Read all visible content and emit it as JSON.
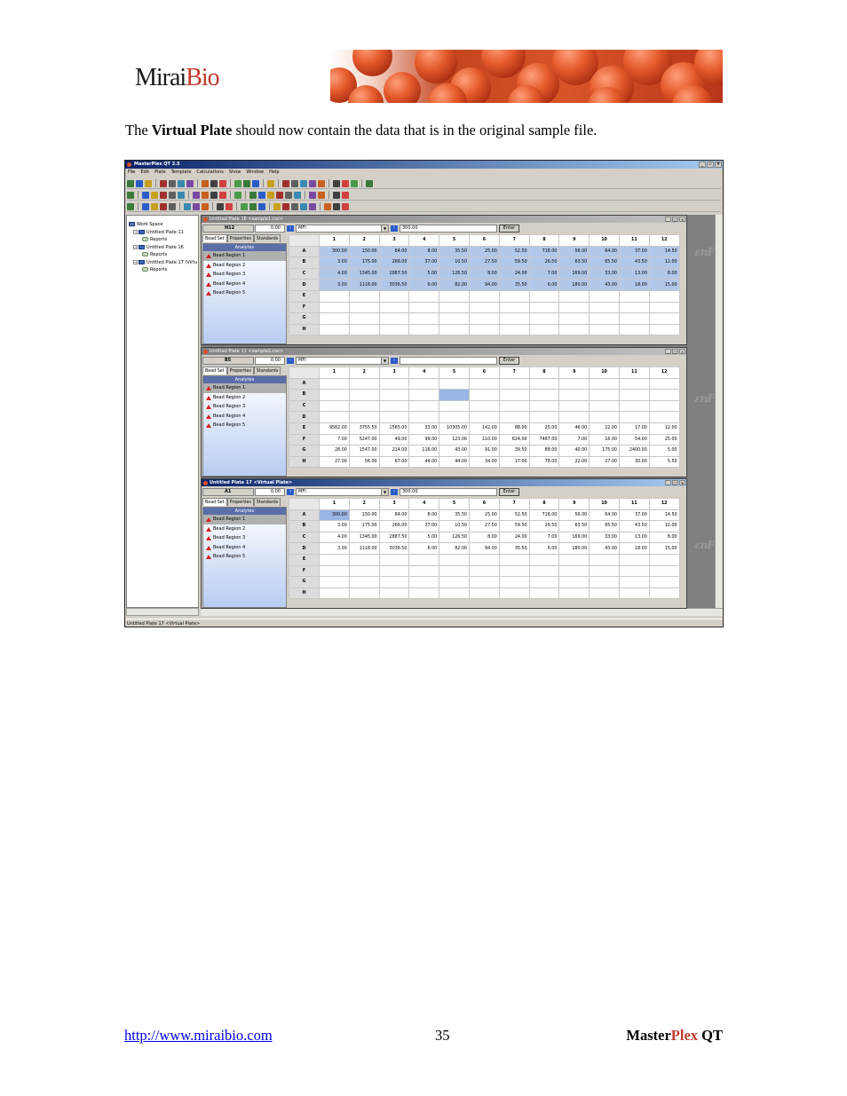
{
  "logo": {
    "part1": "Mirai",
    "part2": "Bio"
  },
  "intro": {
    "before": "The ",
    "bold": "Virtual Plate",
    "after": " should now contain the data that is in the original sample file."
  },
  "app": {
    "title": "MasterPlex QT 2.5",
    "menu": [
      "File",
      "Edit",
      "Plate",
      "Template",
      "Calculations",
      "Show",
      "Window",
      "Help"
    ],
    "status": "Untitled Plate 17 <Virtual Plate>",
    "brand_mark": "ɛnF"
  },
  "tree": {
    "items": [
      {
        "label": "Work Space",
        "type": "workspace",
        "indent": 0,
        "toggle": ""
      },
      {
        "label": "Untitled Plate 11",
        "type": "plate",
        "indent": 1,
        "toggle": "−"
      },
      {
        "label": "Reports",
        "type": "report",
        "indent": 3,
        "toggle": ""
      },
      {
        "label": "Untitled Plate 16",
        "type": "plate",
        "indent": 1,
        "toggle": "−"
      },
      {
        "label": "Reports",
        "type": "report",
        "indent": 3,
        "toggle": ""
      },
      {
        "label": "Untitled Plate 17 (Virtu",
        "type": "plate",
        "indent": 1,
        "toggle": "−"
      },
      {
        "label": "Reports",
        "type": "report",
        "indent": 3,
        "toggle": ""
      }
    ]
  },
  "columns": [
    "1",
    "2",
    "3",
    "4",
    "5",
    "6",
    "7",
    "8",
    "9",
    "10",
    "11",
    "12"
  ],
  "rows": [
    "A",
    "B",
    "C",
    "D",
    "E",
    "F",
    "G",
    "H"
  ],
  "tabs": [
    "Bead Set",
    "Properties",
    "Standards"
  ],
  "analytes_header": "Analytes",
  "analytes": [
    "Bead Region 1",
    "Bead Region 2",
    "Bead Region 3",
    "Bead Region 4",
    "Bead Region 5"
  ],
  "plates": [
    {
      "title": "Untitled Plate 16 <sample1.csv>",
      "active": false,
      "cell_id": "H12",
      "cell_value": "0.00",
      "measure": "MFI",
      "value_field": "300.00",
      "enter_label": "Enter",
      "highlight_rows": [
        0,
        1,
        2,
        3
      ],
      "selected_cell": null,
      "cells": [
        [
          "300.00",
          "150.00",
          "84.00",
          "8.00",
          "35.50",
          "25.00",
          "52.50",
          "718.00",
          "56.00",
          "64.00",
          "37.00",
          "14.50"
        ],
        [
          "3.00",
          "175.00",
          "266.00",
          "37.00",
          "10.50",
          "27.50",
          "59.50",
          "26.50",
          "63.50",
          "65.50",
          "43.50",
          "12.00"
        ],
        [
          "4.00",
          "1345.00",
          "2887.50",
          "5.00",
          "126.50",
          "8.00",
          "24.00",
          "7.00",
          "169.00",
          "33.00",
          "13.00",
          "8.00"
        ],
        [
          "3.00",
          "1118.00",
          "3036.50",
          "6.00",
          "82.00",
          "94.00",
          "35.50",
          "6.00",
          "180.00",
          "43.00",
          "18.00",
          "15.00"
        ],
        [
          "",
          "",
          "",
          "",
          "",
          "",
          "",
          "",
          "",
          "",
          "",
          ""
        ],
        [
          "",
          "",
          "",
          "",
          "",
          "",
          "",
          "",
          "",
          "",
          "",
          ""
        ],
        [
          "",
          "",
          "",
          "",
          "",
          "",
          "",
          "",
          "",
          "",
          "",
          ""
        ],
        [
          "",
          "",
          "",
          "",
          "",
          "",
          "",
          "",
          "",
          "",
          "",
          ""
        ]
      ]
    },
    {
      "title": "Untitled Plate 11 <sample2.csv>",
      "active": false,
      "cell_id": "B5",
      "cell_value": "0.00",
      "measure": "MFI",
      "value_field": "",
      "enter_label": "Enter",
      "highlight_rows": [],
      "selected_cell": [
        1,
        4
      ],
      "cells": [
        [
          "",
          "",
          "",
          "",
          "",
          "",
          "",
          "",
          "",
          "",
          "",
          ""
        ],
        [
          "",
          "",
          "",
          "",
          "",
          "",
          "",
          "",
          "",
          "",
          "",
          ""
        ],
        [
          "",
          "",
          "",
          "",
          "",
          "",
          "",
          "",
          "",
          "",
          "",
          ""
        ],
        [
          "",
          "",
          "",
          "",
          "",
          "",
          "",
          "",
          "",
          "",
          "",
          ""
        ],
        [
          "9582.00",
          "3755.50",
          "1565.00",
          "33.00",
          "10305.00",
          "142.00",
          "88.00",
          "25.00",
          "46.00",
          "22.00",
          "17.00",
          "12.00"
        ],
        [
          "7.00",
          "5247.00",
          "49.00",
          "99.00",
          "123.00",
          "110.00",
          "624.00",
          "7487.00",
          "7.00",
          "16.00",
          "54.00",
          "25.00"
        ],
        [
          "28.00",
          "1547.00",
          "214.00",
          "116.00",
          "43.00",
          "91.00",
          "39.50",
          "88.00",
          "40.00",
          "175.00",
          "2400.00",
          "5.00"
        ],
        [
          "27.00",
          "56.00",
          "67.00",
          "44.00",
          "44.00",
          "34.00",
          "17.00",
          "78.00",
          "22.00",
          "27.00",
          "30.00",
          "5.50"
        ]
      ]
    },
    {
      "title": "Untitled Plate 17 <Virtual Plate>",
      "active": true,
      "cell_id": "A1",
      "cell_value": "0.00",
      "measure": "MFI",
      "value_field": "300.00",
      "enter_label": "Enter",
      "highlight_rows": [],
      "selected_cell": [
        0,
        0
      ],
      "cells": [
        [
          "300.00",
          "150.00",
          "84.00",
          "8.00",
          "35.50",
          "25.00",
          "52.50",
          "718.00",
          "56.00",
          "64.00",
          "37.00",
          "14.50"
        ],
        [
          "3.00",
          "175.00",
          "266.00",
          "37.00",
          "10.50",
          "27.50",
          "59.50",
          "26.50",
          "63.50",
          "65.50",
          "43.50",
          "12.00"
        ],
        [
          "4.00",
          "1345.00",
          "2887.50",
          "5.00",
          "126.50",
          "8.00",
          "24.00",
          "7.00",
          "169.00",
          "33.00",
          "13.00",
          "8.00"
        ],
        [
          "3.00",
          "1118.00",
          "3036.50",
          "6.00",
          "82.00",
          "94.00",
          "35.50",
          "6.00",
          "180.00",
          "43.00",
          "18.00",
          "15.00"
        ],
        [
          "",
          "",
          "",
          "",
          "",
          "",
          "",
          "",
          "",
          "",
          "",
          ""
        ],
        [
          "",
          "",
          "",
          "",
          "",
          "",
          "",
          "",
          "",
          "",
          "",
          ""
        ],
        [
          "",
          "",
          "",
          "",
          "",
          "",
          "",
          "",
          "",
          "",
          "",
          ""
        ],
        [
          "",
          "",
          "",
          "",
          "",
          "",
          "",
          "",
          "",
          "",
          "",
          ""
        ]
      ]
    }
  ],
  "footer": {
    "url": "http://www.miraibio.com",
    "page": "35",
    "brand1": "Master",
    "brand2": "Plex",
    "brand3": " QT"
  }
}
